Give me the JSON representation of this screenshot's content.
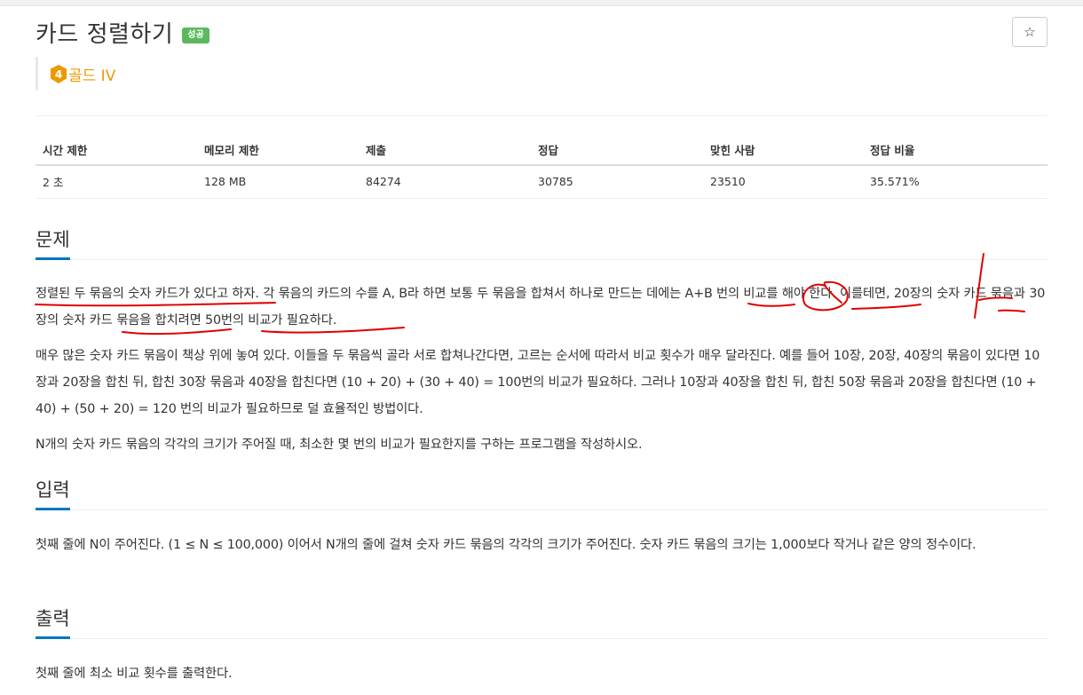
{
  "problem": {
    "title": "카드 정렬하기",
    "status_badge": "성공",
    "tier_number": "4",
    "tier_label": "골드 IV",
    "star_icon": "☆"
  },
  "info_table": {
    "headers": [
      "시간 제한",
      "메모리 제한",
      "제출",
      "정답",
      "맞힌 사람",
      "정답 비율"
    ],
    "values": [
      "2 초",
      "128 MB",
      "84274",
      "30785",
      "23510",
      "35.571%"
    ]
  },
  "sections": {
    "problem_heading": "문제",
    "problem_paragraphs": [
      "정렬된 두 묶음의 숫자 카드가 있다고 하자. 각 묶음의 카드의 수를 A, B라 하면 보통 두 묶음을 합쳐서 하나로 만드는 데에는 A+B 번의 비교를 해야 한다. 이를테면, 20장의 숫자 카드 묶음과 30장의 숫자 카드 묶음을 합치려면 50번의 비교가 필요하다.",
      "매우 많은 숫자 카드 묶음이 책상 위에 놓여 있다. 이들을 두 묶음씩 골라 서로 합쳐나간다면, 고르는 순서에 따라서 비교 횟수가 매우 달라진다. 예를 들어 10장, 20장, 40장의 묶음이 있다면 10장과 20장을 합친 뒤, 합친 30장 묶음과 40장을 합친다면 (10 + 20) + (30 + 40) = 100번의 비교가 필요하다. 그러나 10장과 40장을 합친 뒤, 합친 50장 묶음과 20장을 합친다면 (10 + 40) + (50 + 20) = 120 번의 비교가 필요하므로 덜 효율적인 방법이다.",
      "N개의 숫자 카드 묶음의 각각의 크기가 주어질 때, 최소한 몇 번의 비교가 필요한지를 구하는 프로그램을 작성하시오."
    ],
    "input_heading": "입력",
    "input_paragraph": "첫째 줄에 N이 주어진다. (1 ≤ N ≤ 100,000) 이어서 N개의 줄에 걸쳐 숫자 카드 묶음의 각각의 크기가 주어진다. 숫자 카드 묶음의 크기는 1,000보다 작거나 같은 양의 정수이다.",
    "output_heading": "출력",
    "output_paragraph": "첫째 줄에 최소 비교 횟수를 출력한다."
  },
  "colors": {
    "accent": "#0076c0",
    "success": "#5cb85c",
    "gold_tier": "#ec9a00",
    "annotation": "#e00000"
  },
  "icons": {
    "star": "star-icon",
    "tier": "gold-tier-icon"
  }
}
